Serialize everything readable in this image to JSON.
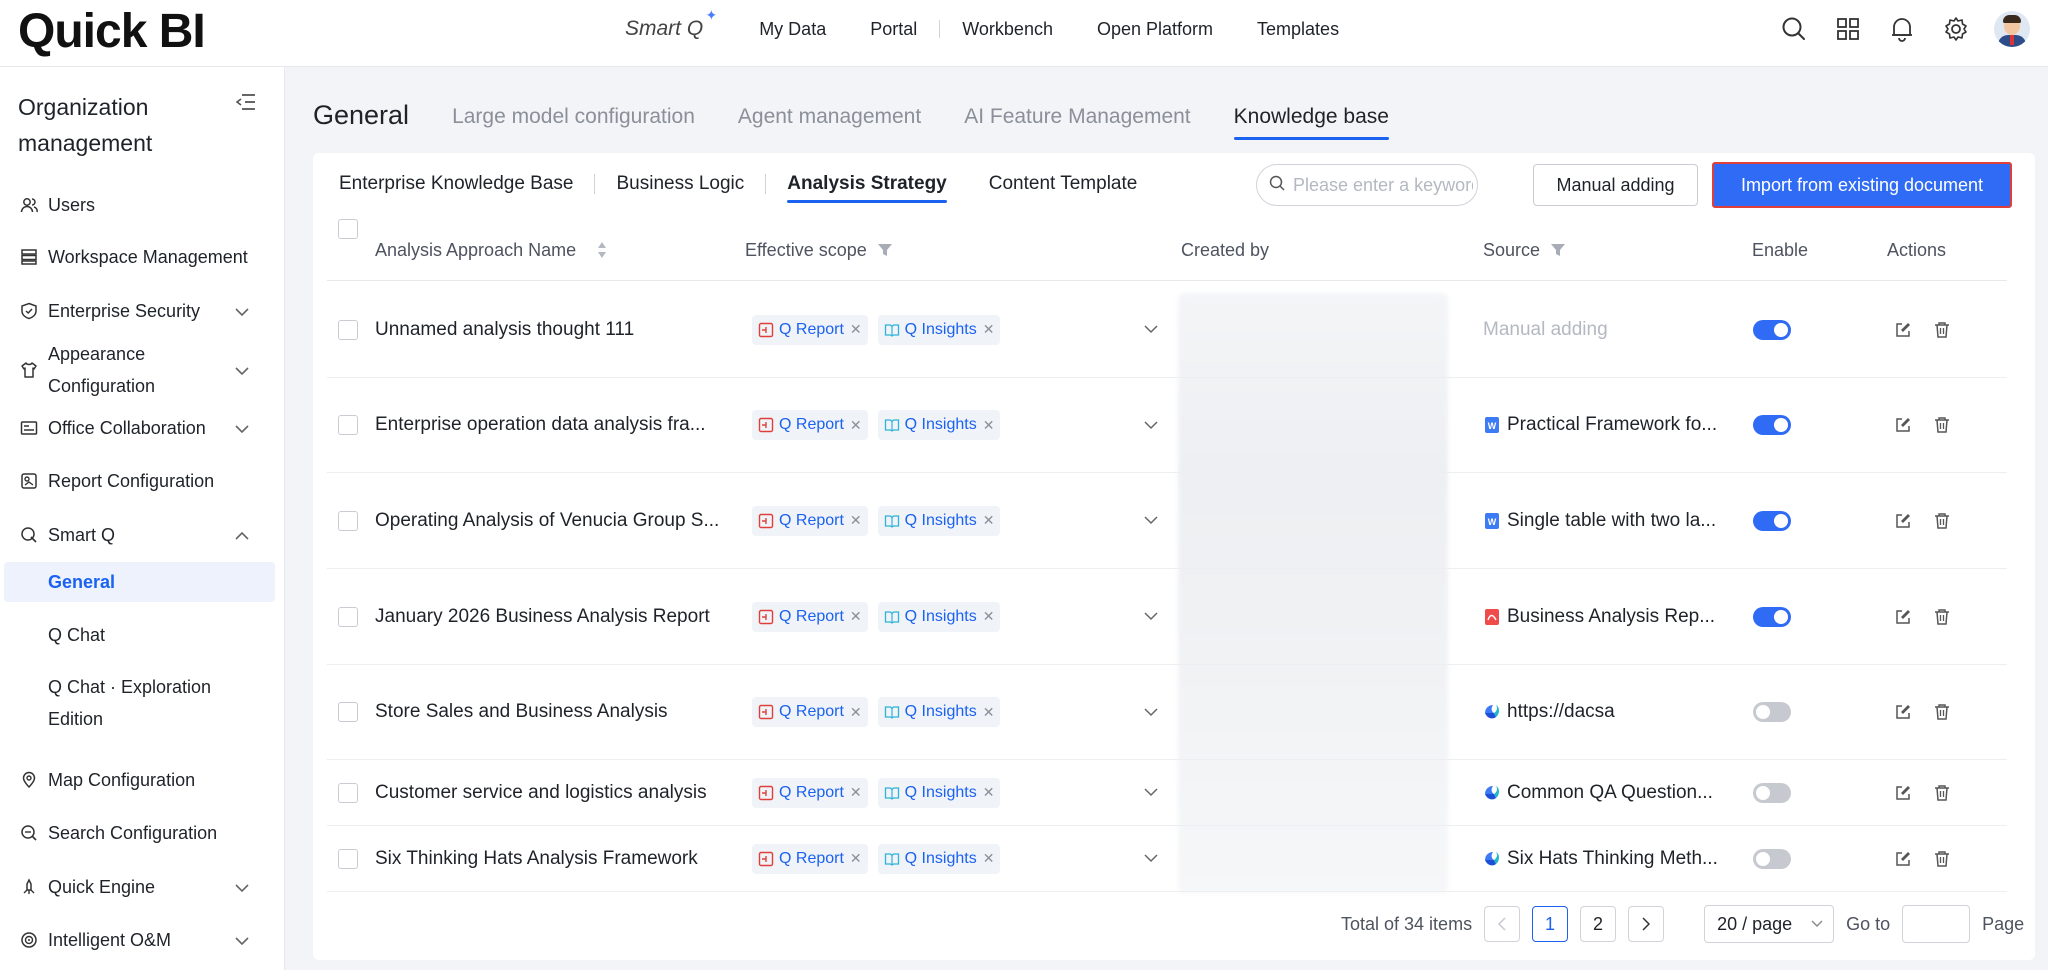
{
  "brand": "Quick BI",
  "topnav": {
    "smart_q": "Smart Q",
    "links": [
      "My Data",
      "Portal",
      "Workbench",
      "Open Platform",
      "Templates"
    ],
    "icons": [
      "search-icon",
      "apps-grid-icon",
      "bell-icon",
      "gear-icon",
      "user-avatar"
    ]
  },
  "sidebar": {
    "title": "Organization management",
    "items": [
      {
        "label": "Users",
        "icon": "users-icon"
      },
      {
        "label": "Workspace Management",
        "icon": "workspace-icon"
      },
      {
        "label": "Enterprise Security",
        "icon": "shield-icon",
        "expandable": true
      },
      {
        "label": "Appearance Configuration",
        "icon": "shirt-icon",
        "expandable": true
      },
      {
        "label": "Office Collaboration",
        "icon": "office-icon",
        "expandable": true
      },
      {
        "label": "Report Configuration",
        "icon": "report-icon"
      },
      {
        "label": "Smart Q",
        "icon": "smartq-icon",
        "expanded": true
      },
      {
        "label": "Map Configuration",
        "icon": "map-icon"
      },
      {
        "label": "Search Configuration",
        "icon": "search-config-icon"
      },
      {
        "label": "Quick Engine",
        "icon": "engine-icon",
        "expandable": true
      },
      {
        "label": "Intelligent O&M",
        "icon": "om-icon",
        "expandable": true
      }
    ],
    "sub_items": [
      "General",
      "Q Chat",
      "Q Chat · Exploration Edition"
    ],
    "active_sub_item": "General"
  },
  "main_tabs": {
    "first": "General",
    "tabs": [
      "Large model configuration",
      "Agent management",
      "AI Feature Management",
      "Knowledge base"
    ],
    "active": "Knowledge base"
  },
  "sub_tabs": {
    "tabs": [
      "Enterprise Knowledge Base",
      "Business Logic",
      "Analysis Strategy",
      "Content Template"
    ],
    "active": "Analysis Strategy"
  },
  "search": {
    "placeholder": "Please enter a keyword.",
    "value": ""
  },
  "buttons": {
    "manual": "Manual adding",
    "import": "Import from existing document"
  },
  "table": {
    "columns": [
      "Analysis Approach Name",
      "Effective scope",
      "Created by",
      "Source",
      "Enable",
      "Actions"
    ],
    "tags": [
      "Q Report",
      "Q Insights"
    ],
    "rows": [
      {
        "name": "Unnamed analysis thought 111",
        "source": "Manual adding",
        "source_icon": "none",
        "enabled": true
      },
      {
        "name": "Enterprise operation data analysis fra...",
        "source": "Practical Framework fo...",
        "source_icon": "word-doc-icon",
        "enabled": true
      },
      {
        "name": "Operating Analysis of Venucia Group S...",
        "source": "Single table with two la...",
        "source_icon": "word-doc-icon",
        "enabled": true
      },
      {
        "name": "January 2026 Business Analysis Report",
        "source": "Business Analysis Rep...",
        "source_icon": "pdf-icon",
        "enabled": true
      },
      {
        "name": "Store Sales and Business Analysis",
        "source": "https://dacsa",
        "source_icon": "web-icon",
        "enabled": false
      },
      {
        "name": "Customer service and logistics analysis",
        "source": "Common QA Question...",
        "source_icon": "web-icon",
        "enabled": false
      },
      {
        "name": "Six Thinking Hats Analysis Framework",
        "source": "Six Hats Thinking Meth...",
        "source_icon": "web-icon",
        "enabled": false
      }
    ]
  },
  "pagination": {
    "total": "Total of 34 items",
    "pages": [
      "1",
      "2"
    ],
    "current": "1",
    "page_size": "20 / page",
    "goto_label": "Go to",
    "page_label": "Page"
  },
  "colors": {
    "accent": "#1b62f1",
    "button": "#2f6bf5",
    "highlight_border": "#e0403a"
  }
}
